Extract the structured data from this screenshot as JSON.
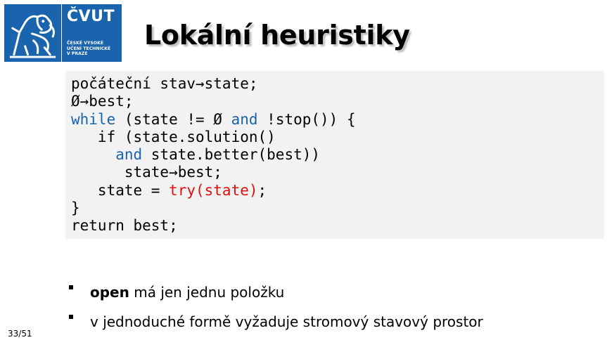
{
  "logo": {
    "name": "ČVUT",
    "sub_lines": [
      "ČESKÉ VYSOKÉ",
      "UČENÍ TECHNICKÉ",
      "V PRAZE"
    ],
    "emblem_icon": "lion-emblem-icon",
    "color": "#1a63ad"
  },
  "title": "Lokální heuristiky",
  "code": {
    "lines": [
      [
        "počáteční stav→state;"
      ],
      [
        "Ø→best;"
      ],
      [
        "while",
        " (state != Ø ",
        "and",
        " !stop()) {"
      ],
      [
        "   if (state.solution()"
      ],
      [
        "     ",
        "and",
        " state.better(best))"
      ],
      [
        "      state→best;"
      ],
      [
        "   state = ",
        "try(state)",
        ";"
      ],
      [
        "}"
      ],
      [
        "return best;"
      ]
    ],
    "keyword_color": "#1a63ad",
    "highlight_color": "#e01010",
    "background": "#f2f2f2"
  },
  "bullets": [
    {
      "bold": "open",
      "text": " má jen jednu položku"
    },
    {
      "bold": "",
      "text": "v jednoduché formě vyžaduje stromový stavový prostor"
    }
  ],
  "page_number": "33/51"
}
